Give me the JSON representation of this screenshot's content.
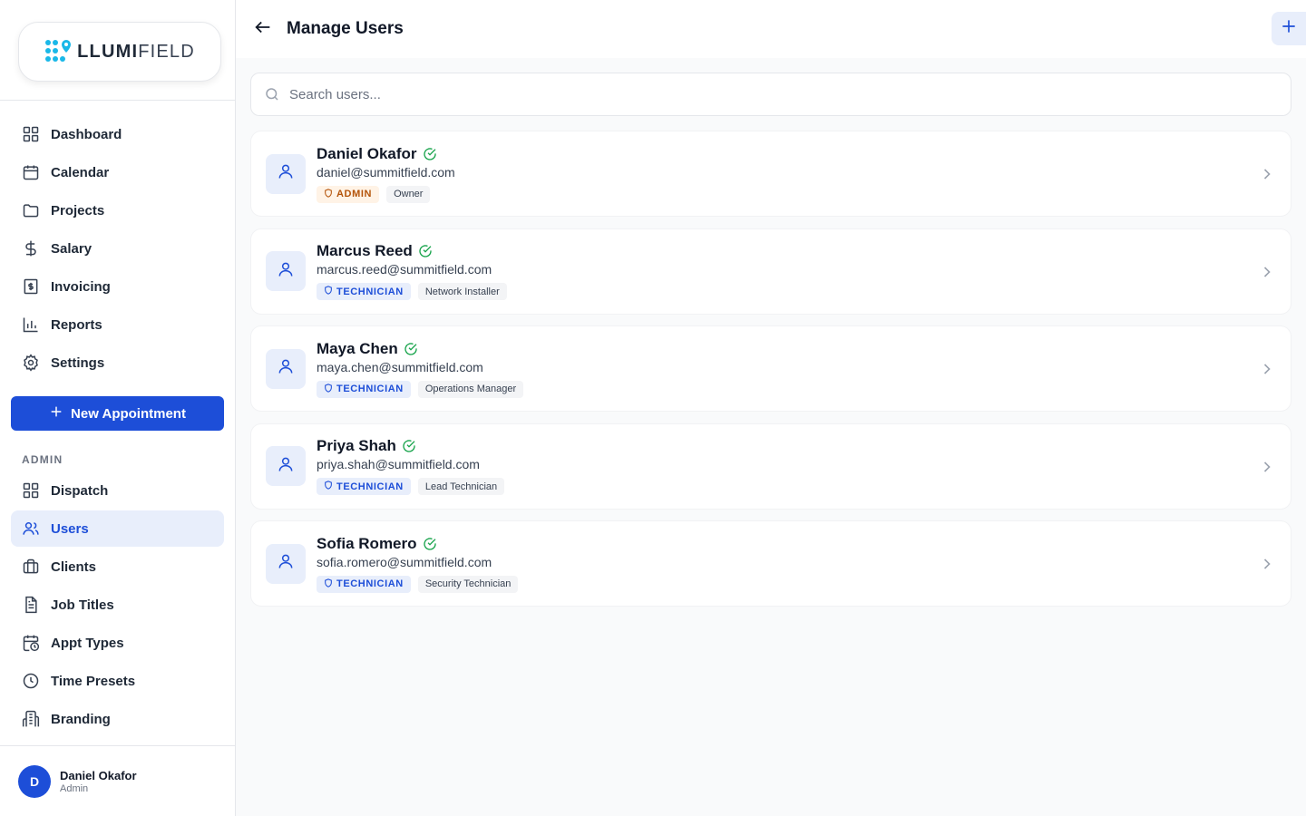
{
  "brand": {
    "logo_bold": "LLUMI",
    "logo_light": "FIELD",
    "accent": "#1d4ed8",
    "logo_dots_color": "#1ab8e8"
  },
  "sidebar": {
    "nav": [
      {
        "label": "Dashboard",
        "icon": "grid-icon"
      },
      {
        "label": "Calendar",
        "icon": "calendar-icon"
      },
      {
        "label": "Projects",
        "icon": "folder-icon"
      },
      {
        "label": "Salary",
        "icon": "dollar-icon"
      },
      {
        "label": "Invoicing",
        "icon": "invoice-icon"
      },
      {
        "label": "Reports",
        "icon": "bar-chart-icon"
      },
      {
        "label": "Settings",
        "icon": "gear-icon"
      }
    ],
    "new_appointment_label": "New Appointment",
    "admin_section_title": "ADMIN",
    "admin_nav": [
      {
        "label": "Dispatch",
        "icon": "grid-icon"
      },
      {
        "label": "Users",
        "icon": "users-icon",
        "active": true
      },
      {
        "label": "Clients",
        "icon": "briefcase-icon"
      },
      {
        "label": "Job Titles",
        "icon": "document-icon"
      },
      {
        "label": "Appt Types",
        "icon": "calendar-clock-icon"
      },
      {
        "label": "Time Presets",
        "icon": "clock-icon"
      },
      {
        "label": "Branding",
        "icon": "building-icon"
      }
    ],
    "current_user": {
      "initial": "D",
      "name": "Daniel Okafor",
      "role": "Admin"
    }
  },
  "header": {
    "title": "Manage Users"
  },
  "search": {
    "placeholder": "Search users...",
    "value": ""
  },
  "users": [
    {
      "name": "Daniel Okafor",
      "email": "daniel@summitfield.com",
      "role": "ADMIN",
      "title": "Owner",
      "verified": true
    },
    {
      "name": "Marcus Reed",
      "email": "marcus.reed@summitfield.com",
      "role": "TECHNICIAN",
      "title": "Network Installer",
      "verified": true
    },
    {
      "name": "Maya Chen",
      "email": "maya.chen@summitfield.com",
      "role": "TECHNICIAN",
      "title": "Operations Manager",
      "verified": true
    },
    {
      "name": "Priya Shah",
      "email": "priya.shah@summitfield.com",
      "role": "TECHNICIAN",
      "title": "Lead Technician",
      "verified": true
    },
    {
      "name": "Sofia Romero",
      "email": "sofia.romero@summitfield.com",
      "role": "TECHNICIAN",
      "title": "Security Technician",
      "verified": true
    }
  ]
}
